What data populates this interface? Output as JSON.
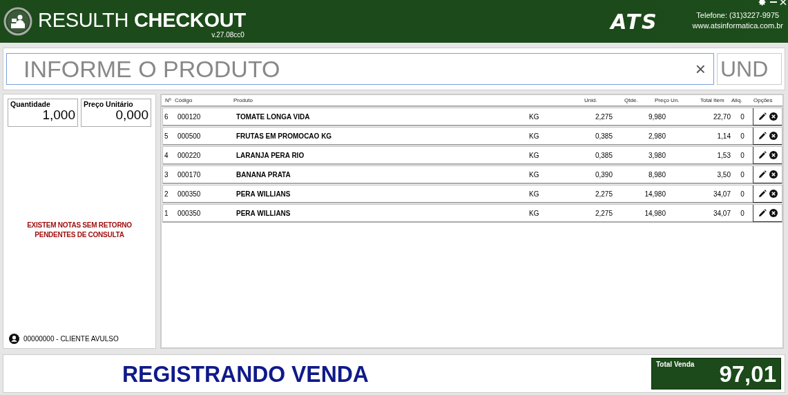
{
  "header": {
    "title": "RESULTH **CHECKOUT**",
    "version": "v.27.08cc0",
    "brand": "ATS",
    "phone": "Telefone: (31)3227-9975",
    "website": "www.atsinformatica.com.br"
  },
  "search": {
    "placeholder": "INFORME O PRODUTO",
    "clear": "×",
    "unit": "UND"
  },
  "inputs": [
    {
      "label": "Quantidade",
      "value": "1,000"
    },
    {
      "label": "Preço Unitário",
      "value": "0,000"
    }
  ],
  "alert": "EXISTEM NOTAS SEM RETORNO PENDENTES DE CONSULTA",
  "customer": "00000000 - CLIENTE AVULSO",
  "table": {
    "columns": [
      "Nº",
      "Código",
      "Produto",
      "Unid.",
      "Qtde.",
      "Preço Un.",
      "Total Item",
      "Aliq.",
      "Opções"
    ],
    "rows": [
      {
        "cells": [
          "6",
          "000120",
          "TOMATE LONGA VIDA",
          "KG",
          "2,275",
          "9,980",
          "22,70",
          "0"
        ]
      },
      {
        "cells": [
          "5",
          "000500",
          "FRUTAS EM PROMOCAO KG",
          "KG",
          "0,385",
          "2,980",
          "1,14",
          "0"
        ]
      },
      {
        "cells": [
          "4",
          "000220",
          "LARANJA PERA RIO",
          "KG",
          "0,385",
          "3,980",
          "1,53",
          "0"
        ]
      },
      {
        "cells": [
          "3",
          "000170",
          "BANANA PRATA",
          "KG",
          "0,390",
          "8,980",
          "3,50",
          "0"
        ]
      },
      {
        "cells": [
          "2",
          "000350",
          "PERA WILLIANS",
          "KG",
          "2,275",
          "14,980",
          "34,07",
          "0"
        ]
      },
      {
        "cells": [
          "1",
          "000350",
          "PERA WILLIANS",
          "KG",
          "2,275",
          "14,980",
          "34,07",
          "0"
        ]
      }
    ]
  },
  "status": "REGISTRANDO VENDA",
  "total": {
    "label": "Total Venda",
    "value": "97,01"
  }
}
